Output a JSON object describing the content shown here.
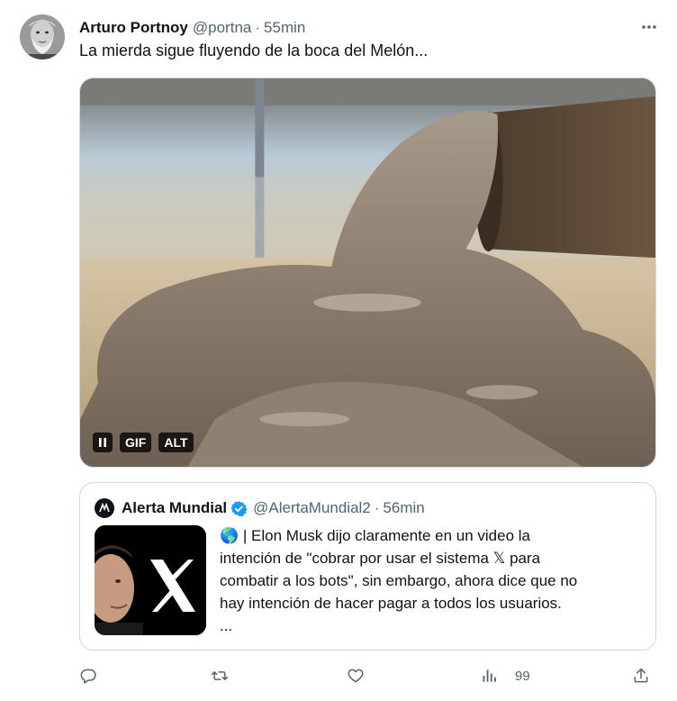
{
  "tweet": {
    "author_name": "Arturo Portnoy",
    "handle": "@portna",
    "separator": "·",
    "time": "55min",
    "text": "La mierda sigue fluyendo de la boca del Melón...",
    "more_icon": "more-horizontal-icon"
  },
  "media": {
    "type": "gif",
    "pause_icon": "pause-icon",
    "gif_badge": "GIF",
    "alt_badge": "ALT"
  },
  "quote": {
    "author_name": "Alerta Mundial",
    "handle": "@AlertaMundial2",
    "separator": "·",
    "time": "56min",
    "verified": true,
    "lines": [
      "🌎 | Elon Musk dijo claramente en un video la",
      "intención de \"cobrar por usar el sistema 𝕏 para",
      "combatir a los bots\", sin embargo, ahora dice que no",
      "hay intención de hacer pagar a todos los usuarios.",
      "..."
    ]
  },
  "actions": {
    "reply_icon": "reply-icon",
    "retweet_icon": "retweet-icon",
    "like_icon": "like-icon",
    "views_icon": "views-icon",
    "views_count": "99",
    "share_icon": "share-icon"
  },
  "colors": {
    "text_primary": "#0f1419",
    "text_secondary": "#536471",
    "border": "#cfd9de",
    "verified": "#1d9bf0"
  }
}
